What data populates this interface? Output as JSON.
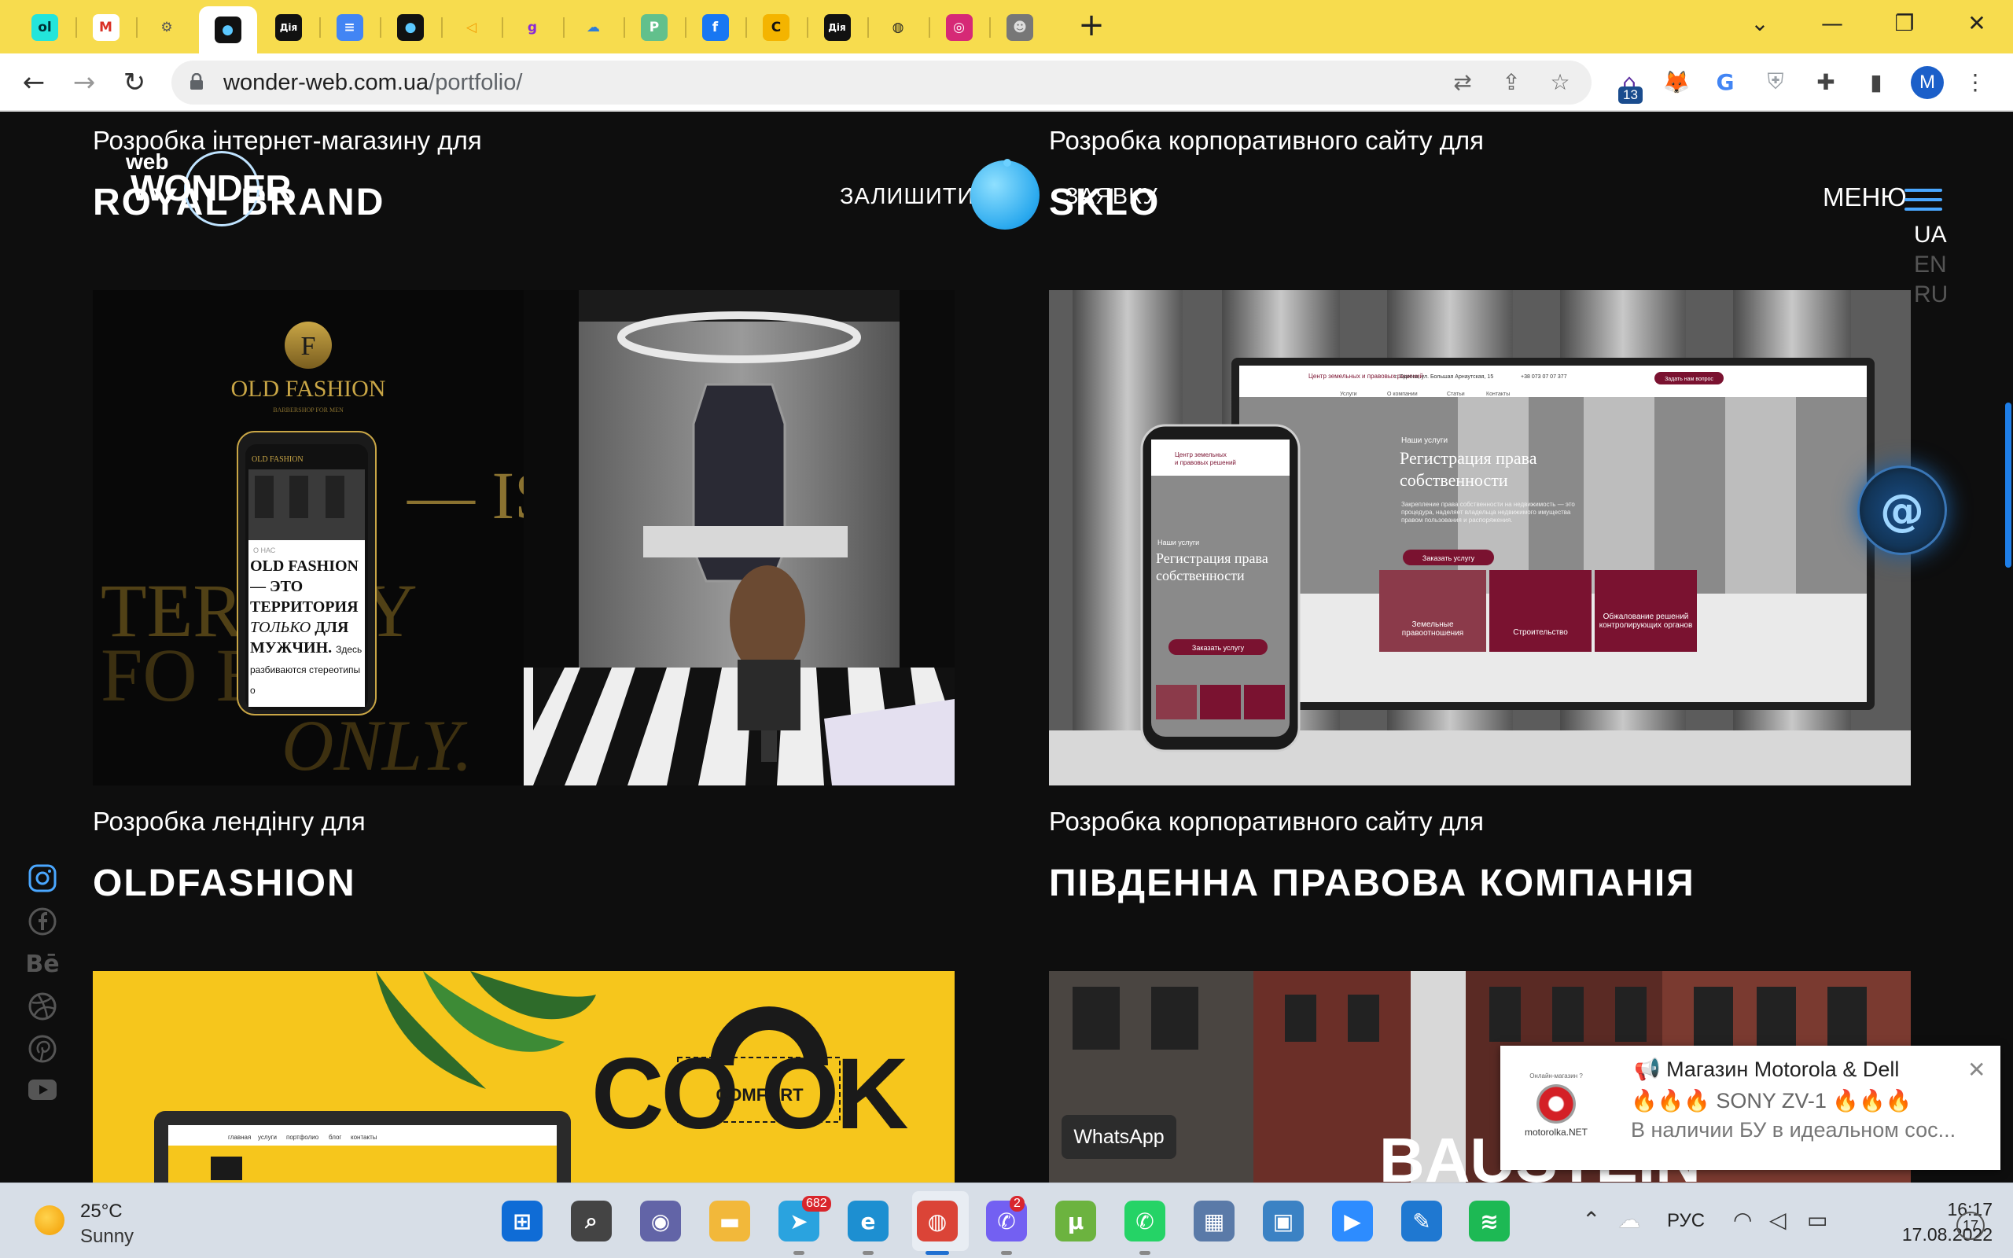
{
  "browser": {
    "tabs": [
      {
        "icon": "olx-icon",
        "glyph": "ol",
        "color": "#23e5db",
        "fg": "#002f34"
      },
      {
        "icon": "gmail-icon",
        "glyph": "M",
        "color": "#ffffff",
        "fg": "#d93025"
      },
      {
        "icon": "settings-icon",
        "glyph": "⚙",
        "color": "#f7dc4e",
        "fg": "#555555"
      },
      {
        "icon": "wonder-web-icon",
        "glyph": "●",
        "color": "#111111",
        "fg": "#5bc8ff"
      },
      {
        "icon": "diia-icon",
        "glyph": "Дія",
        "color": "#111111",
        "fg": "#ffffff"
      },
      {
        "icon": "google-docs-icon",
        "glyph": "≡",
        "color": "#4285f4",
        "fg": "#ffffff"
      },
      {
        "icon": "wonder-web-icon-2",
        "glyph": "●",
        "color": "#111111",
        "fg": "#5bc8ff"
      },
      {
        "icon": "send-icon",
        "glyph": "◁",
        "color": "#f7dc4e",
        "fg": "#f29b00"
      },
      {
        "icon": "g-icon",
        "glyph": "g",
        "color": "#f7dc4e",
        "fg": "#8b2bd6"
      },
      {
        "icon": "cloud-icon",
        "glyph": "☁",
        "color": "#f7dc4e",
        "fg": "#2f7ed8"
      },
      {
        "icon": "p-icon",
        "glyph": "P",
        "color": "#62c08c",
        "fg": "#ffffff"
      },
      {
        "icon": "facebook-icon",
        "glyph": "f",
        "color": "#1877f2",
        "fg": "#ffffff"
      },
      {
        "icon": "c-icon",
        "glyph": "C",
        "color": "#f4b400",
        "fg": "#111111"
      },
      {
        "icon": "diia-icon-2",
        "glyph": "Дія",
        "color": "#111111",
        "fg": "#ffffff"
      },
      {
        "icon": "globe-icon",
        "glyph": "◍",
        "color": "#f7dc4e",
        "fg": "#222222"
      },
      {
        "icon": "instagram-icon",
        "glyph": "◎",
        "color": "#d62976",
        "fg": "#ffffff"
      },
      {
        "icon": "avatar-tab-icon",
        "glyph": "☻",
        "color": "#777777",
        "fg": "#dddddd"
      }
    ],
    "new_tab": "+",
    "window_controls": {
      "collapse": "⌄",
      "minimize": "—",
      "restore": "❐",
      "close": "✕"
    },
    "nav": {
      "back": "←",
      "forward": "→",
      "reload": "↻"
    },
    "url": {
      "domain": "wonder-web.com.ua",
      "path": "/portfolio/"
    },
    "omni_icons": {
      "translate": "⇄",
      "share": "⇪",
      "bookmark": "☆"
    },
    "extensions": {
      "badge": "13",
      "fox": "🦊",
      "translate_ext": "G",
      "shield": "⛨",
      "puzzle": "✚",
      "sidepanel": "▮",
      "more": "⋮"
    },
    "profile_initial": "M"
  },
  "site": {
    "logo": {
      "web": "web",
      "wonder": "WONDER"
    },
    "leave": "ЗАЛИШИТИ",
    "request": "ЗАЯВКУ",
    "menu": "МЕНЮ",
    "languages": [
      "UA",
      "EN",
      "RU"
    ],
    "social": {
      "behance": "Bē"
    },
    "contact_glyph": "@"
  },
  "projects": [
    {
      "subtitle": "Розробка інтернет-магазину для",
      "title": "ROYAL BRAND"
    },
    {
      "subtitle": "Розробка корпоративного сайту для",
      "title": "SKLO"
    },
    {
      "subtitle": "Розробка лендінгу для",
      "title": "OLDFASHION"
    },
    {
      "subtitle": "Розробка корпоративного сайту для",
      "title": "ПІВДЕННА ПРАВОВА КОМПАНІЯ"
    }
  ],
  "oldfashion_image": {
    "brand": "OLD FASHION",
    "brand_sub": "BARBERSHOP FOR MEN",
    "bg_line1": "— IS A",
    "bg_line2": "TER    ORY",
    "bg_line3": "FO      EN",
    "bg_line4": "ONLY.",
    "phone_header": "OLD FASHION",
    "phone_small": "О НАС",
    "phone_text": "OLD FASHION— ЭТО ТЕРРИТОРИЯ",
    "phone_italic": "ТОЛЬКО",
    "phone_text2": "ДЛЯ МУЖЧИН.",
    "phone_foot": "Здесь разбиваются стереотипы о"
  },
  "legal_image": {
    "org": "Центр земельных и правовых решений",
    "address": "г. Одесса, ул. Большая Арнаутская, 15",
    "phones": "+38 073 07 07 377",
    "cta": "Задать нам вопрос",
    "nav": [
      "Услуги",
      "О компании",
      "Статьи",
      "Контакты"
    ],
    "section": "Наши услуги",
    "headline": "Регистрация права собственности",
    "body": "Закрепление права собственности на недвижимость — это процедура, наделяет владельца недвижимого имущества правом пользования и распоряжения.",
    "button": "Заказать услугу",
    "cards": [
      "Земельные правоотношения",
      "Строительство",
      "Обжалование решений контролирующих органов"
    ]
  },
  "comfort_image": {
    "word": "CO  OK",
    "tag": "COMFORT",
    "nav": [
      "главная",
      "услуги",
      "портфолио",
      "блог",
      "контакты"
    ]
  },
  "street_image": {
    "sign": "BAUSTEIN"
  },
  "whatsapp_tooltip": "WhatsApp",
  "notification": {
    "logo_top": "Онлайн-магазин ?",
    "logo_name": "motorolka.NET",
    "title": "📢 Магазин Motorola & Dell",
    "line1": "🔥🔥🔥 SONY ZV-1 🔥🔥🔥",
    "line2": "В наличии БУ в идеальном сос...",
    "close": "✕"
  },
  "taskbar": {
    "weather": {
      "temp": "25°C",
      "condition": "Sunny"
    },
    "apps": [
      {
        "name": "start-icon",
        "glyph": "⊞",
        "color": "#0f6cd6"
      },
      {
        "name": "search-icon",
        "glyph": "⌕",
        "color": "#444444"
      },
      {
        "name": "teams-chat-icon",
        "glyph": "◉",
        "color": "#6264a7"
      },
      {
        "name": "file-explorer-icon",
        "glyph": "▬",
        "color": "#f2b83a"
      },
      {
        "name": "telegram-icon",
        "glyph": "➤",
        "color": "#2aa3df",
        "badge": "682"
      },
      {
        "name": "edge-icon",
        "glyph": "e",
        "color": "#1d8fd1"
      },
      {
        "name": "chrome-icon",
        "glyph": "◍",
        "color": "#db4437"
      },
      {
        "name": "viber-icon",
        "glyph": "✆",
        "color": "#7360f2",
        "badge": "2"
      },
      {
        "name": "utorrent-icon",
        "glyph": "µ",
        "color": "#6cb33f"
      },
      {
        "name": "whatsapp-icon",
        "glyph": "✆",
        "color": "#25d366"
      },
      {
        "name": "calculator-icon",
        "glyph": "▦",
        "color": "#5a7aa8"
      },
      {
        "name": "control-panel-icon",
        "glyph": "▣",
        "color": "#3b82c4"
      },
      {
        "name": "zoom-icon",
        "glyph": "▶",
        "color": "#2d8cff"
      },
      {
        "name": "tool-icon",
        "glyph": "✎",
        "color": "#1f78d1"
      },
      {
        "name": "spotify-icon",
        "glyph": "≋",
        "color": "#1db954"
      }
    ],
    "tray": {
      "chevron": "⌃",
      "cloud": "☁",
      "lang": "РУС",
      "wifi": "◠",
      "volume": "◁",
      "battery": "▭"
    },
    "time": "16:17",
    "date": "17.08.2022",
    "notification_count": "17"
  }
}
